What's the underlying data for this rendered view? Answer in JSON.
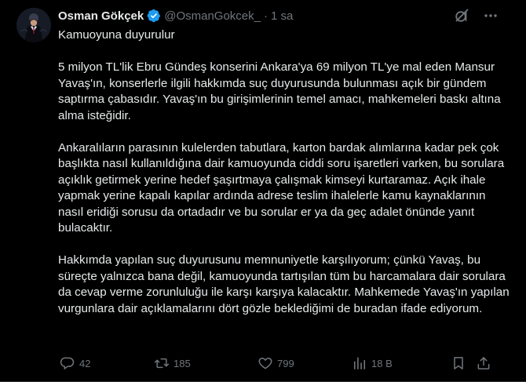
{
  "tweet": {
    "author_name": "Osman Gökçek",
    "handle": "@OsmanGokcek_",
    "separator": "·",
    "time": "1 sa",
    "title_line": "Kamuoyuna duyurulur",
    "paragraphs": [
      "5 milyon TL'lik Ebru Gündeş konserini Ankara'ya 69 milyon TL'ye mal eden Mansur Yavaş'ın, konserlerle ilgili hakkımda suç duyurusunda bulunması açık bir gündem saptırma çabasıdır. Yavaş'ın bu girişimlerinin temel amacı, mahkemeleri baskı altına alma isteğidir.",
      "Ankaralıların parasının kulelerden tabutlara, karton bardak alımlarına kadar pek çok başlıkta nasıl kullanıldığına dair kamuoyunda ciddi soru işaretleri varken, bu sorulara açıklık getirmek yerine hedef şaşırtmaya çalışmak kimseyi kurtaramaz. Açık ihale yapmak yerine kapalı kapılar ardında adrese teslim ihalelerle kamu kaynaklarının nasıl eridiği sorusu da ortadadır ve bu sorular er ya da geç adalet önünde yanıt bulacaktır.",
      "Hakkımda yapılan suç duyurusunu memnuniyetle karşılıyorum; çünkü Yavaş, bu süreçte yalnızca bana değil, kamuoyunda tartışılan tüm bu harcamalara dair sorulara da cevap verme zorunluluğu ile karşı karşıya kalacaktır. Mahkemede Yavaş'ın yapılan vurgunlara dair açıklamalarını dört gözle beklediğimi de buradan ifade ediyorum."
    ],
    "actions": {
      "replies": "42",
      "retweets": "185",
      "likes": "799",
      "views": "18 B"
    }
  },
  "colors": {
    "background": "#000000",
    "text": "#e7e9ea",
    "secondary": "#71767b",
    "verified": "#1d9bf0"
  },
  "icons": {
    "verified": "verified-badge-icon",
    "grok": "grok-icon",
    "more": "more-icon",
    "reply": "reply-icon",
    "retweet": "retweet-icon",
    "like": "heart-icon",
    "views": "views-icon",
    "bookmark": "bookmark-icon",
    "share": "share-icon"
  }
}
